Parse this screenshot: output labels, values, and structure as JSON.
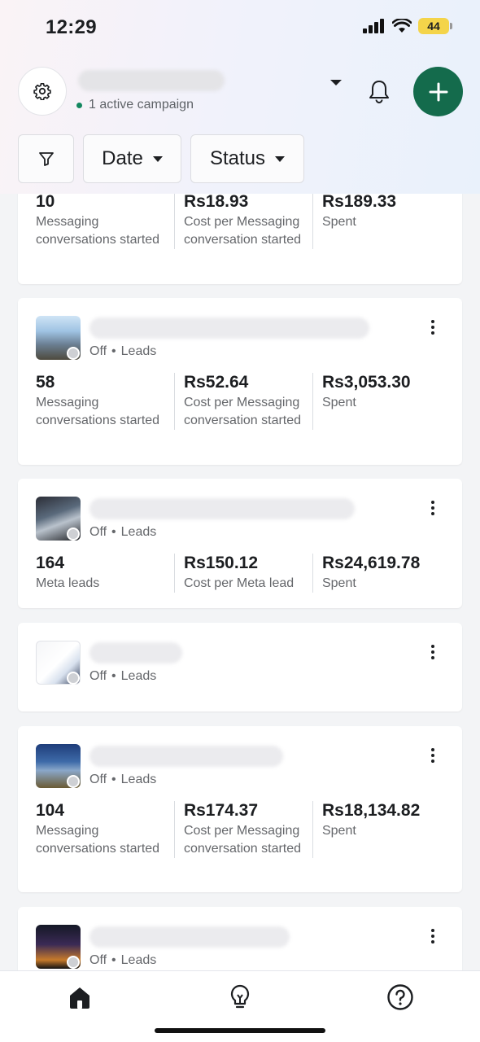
{
  "status_bar": {
    "time": "12:29",
    "battery": "44"
  },
  "header": {
    "active_campaign_text": "1 active campaign"
  },
  "filters": {
    "date_label": "Date",
    "status_label": "Status"
  },
  "cards": [
    {
      "metrics": [
        {
          "value": "10",
          "label": "Messaging conversations started"
        },
        {
          "value": "Rs18.93",
          "label": "Cost per Messaging conversation started"
        },
        {
          "value": "Rs189.33",
          "label": "Spent"
        }
      ]
    },
    {
      "status": "Off",
      "separator": "•",
      "objective": "Leads",
      "metrics": [
        {
          "value": "58",
          "label": "Messaging conversations started"
        },
        {
          "value": "Rs52.64",
          "label": "Cost per Messaging conversation started"
        },
        {
          "value": "Rs3,053.30",
          "label": "Spent"
        }
      ]
    },
    {
      "status": "Off",
      "separator": "•",
      "objective": "Leads",
      "metrics": [
        {
          "value": "164",
          "label": "Meta leads"
        },
        {
          "value": "Rs150.12",
          "label": "Cost per Meta lead"
        },
        {
          "value": "Rs24,619.78",
          "label": "Spent"
        }
      ]
    },
    {
      "status": "Off",
      "separator": "•",
      "objective": "Leads"
    },
    {
      "status": "Off",
      "separator": "•",
      "objective": "Leads",
      "metrics": [
        {
          "value": "104",
          "label": "Messaging conversations started"
        },
        {
          "value": "Rs174.37",
          "label": "Cost per Messaging conversation started"
        },
        {
          "value": "Rs18,134.82",
          "label": "Spent"
        }
      ]
    },
    {
      "status": "Off",
      "separator": "•",
      "objective": "Leads"
    }
  ],
  "bottom_nav": [
    "home-icon",
    "lightbulb-icon",
    "help-icon"
  ]
}
